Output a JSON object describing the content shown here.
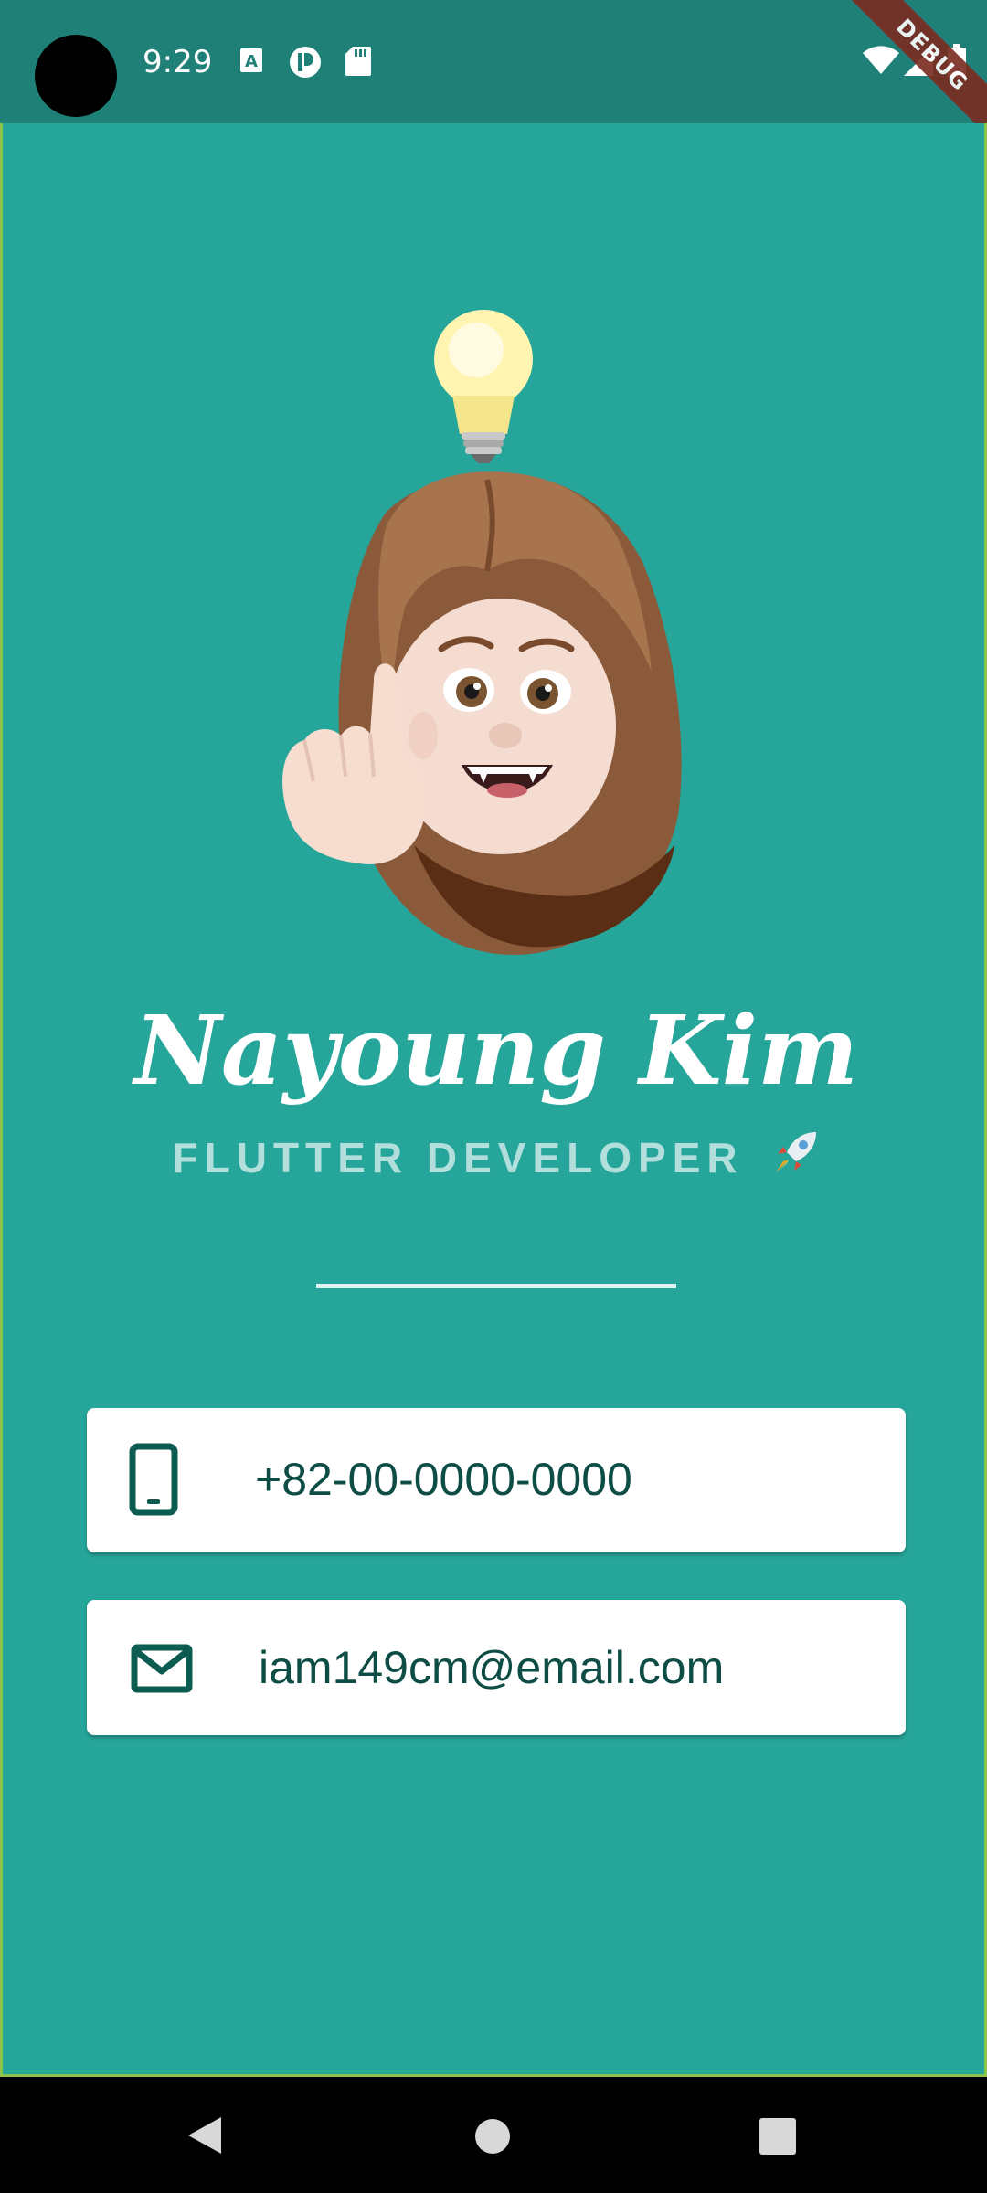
{
  "status_bar": {
    "time": "9:29",
    "icons_left": [
      "text-a-icon",
      "pocket-p-icon",
      "sd-card-icon"
    ],
    "icons_right": [
      "wifi-icon",
      "cell-signal-icon",
      "battery-icon"
    ],
    "debug_banner": "DEBUG"
  },
  "profile": {
    "name": "Nayoung Kim",
    "job_title": "FLUTTER DEVELOPER",
    "job_emoji": "🚀"
  },
  "contact": {
    "phone": "+82-00-0000-0000",
    "email": "iam149cm@email.com"
  },
  "colors": {
    "background": "#26a69a",
    "status_bar": "#1f8077",
    "card_text": "#0d4d45",
    "subtitle": "#b2dfdb"
  },
  "nav_bar": {
    "buttons": [
      "back-icon",
      "home-icon",
      "recents-icon"
    ]
  }
}
